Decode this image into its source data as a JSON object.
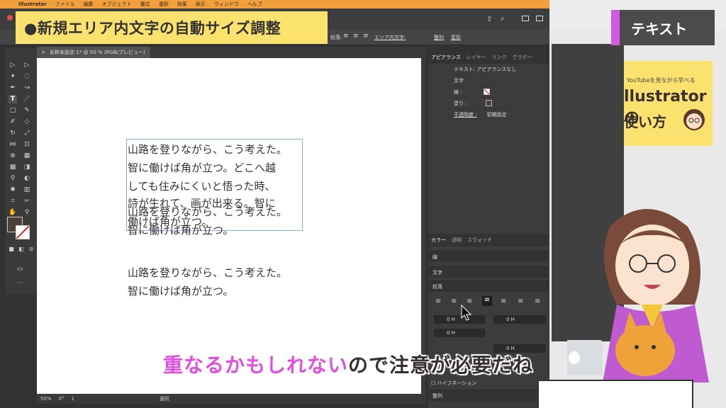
{
  "menubar": {
    "app": "Illustrator",
    "items": [
      "ファイル",
      "編集",
      "オブジェクト",
      "書式",
      "選択",
      "効果",
      "表示",
      "ウィンドウ",
      "ヘルプ"
    ]
  },
  "title_banner": "●新規エリア内文字の自動サイズ調整",
  "control_bar": {
    "paragraph_label": "段落:",
    "area_type_label": "エリア内文字:",
    "align_label": "整列",
    "transform_label": "変形"
  },
  "document_tab": {
    "close": "×",
    "title": "名称未設定-1* @ 50 % (RGB/プレビュー)"
  },
  "canvas": {
    "frame_lines": [
      "山路を登りながら、こう考えた。",
      "智に働けば角が立つ。どこへ越",
      "しても住みにくいと悟った時、",
      "詩が生れて、画が出来る。智に",
      "働けば角が立つ。"
    ],
    "overlap_lines": [
      "山路を登りながら、こう考えた。",
      "智に働けば角が立つ。"
    ],
    "third_lines": [
      "山路を登りながら、こう考えた。",
      "智に働けば角が立つ。"
    ]
  },
  "status": {
    "zoom": "50%",
    "rotation": "0°",
    "artboard": "1",
    "tool": "選択"
  },
  "appearance_panel": {
    "tabs": [
      "アピアランス",
      "レイヤー",
      "リンク",
      "グラデー"
    ],
    "header": "テキスト: アピアランスなし",
    "rows": [
      {
        "label": "文字"
      },
      {
        "label": "線 :"
      },
      {
        "label": "塗り :"
      },
      {
        "label": "不透明度 :",
        "value": "初期設定"
      }
    ]
  },
  "lower_panels": {
    "color_tabs": [
      "カラー",
      "透明",
      "スウォッチ"
    ],
    "stroke": "線",
    "character": "文字",
    "paragraph": "段落",
    "indent_left": "0 H",
    "indent_right": "0 H",
    "indent_first": "0 H",
    "space_before": "0 H",
    "hyphenation": "ハイフネーション",
    "align": "整列"
  },
  "overlay": {
    "tag": "テキスト",
    "book_small": "YouTubeを見ながら学べる",
    "book_line1": "llustratorの",
    "book_line2": "使い方"
  },
  "subtitle": {
    "pink": "重なるかもしれない",
    "dark": "ので注意が必要だね"
  },
  "colors": {
    "accent_pink": "#e24fe0",
    "banner_yellow": "#fbe26e",
    "menubar_orange": "#f2a03d"
  }
}
